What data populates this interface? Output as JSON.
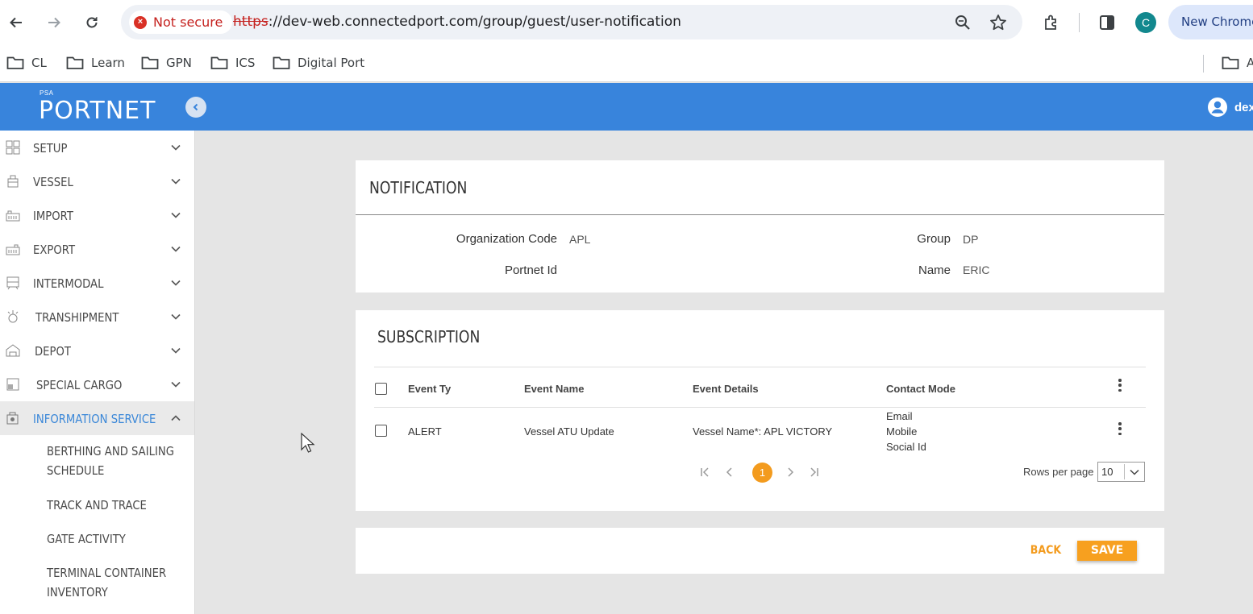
{
  "browser": {
    "security_label": "Not secure",
    "url_scheme": "https",
    "url_rest": "://dev-web.connectedport.com/group/guest/user-notification",
    "profile_initial": "C",
    "new_chrome_label": "New Chrome",
    "bookmarks": [
      "CL",
      "Learn",
      "GPN",
      "ICS",
      "Digital Port"
    ],
    "bookmark_right_fragment": "A"
  },
  "app": {
    "logo_small": "PSA",
    "logo_main": "PORTNET",
    "user_fragment": "dex",
    "accent_color": "#3884dc",
    "action_color": "#f39b1e"
  },
  "sidebar": {
    "items": [
      {
        "label": "SETUP",
        "icon": "grid-icon",
        "expanded": false
      },
      {
        "label": "VESSEL",
        "icon": "ship-icon",
        "expanded": false
      },
      {
        "label": "IMPORT",
        "icon": "import-icon",
        "expanded": false
      },
      {
        "label": "EXPORT",
        "icon": "export-icon",
        "expanded": false
      },
      {
        "label": "INTERMODAL",
        "icon": "train-icon",
        "expanded": false
      },
      {
        "label": "TRANSHIPMENT",
        "icon": "crane-icon",
        "expanded": false
      },
      {
        "label": "DEPOT",
        "icon": "warehouse-icon",
        "expanded": false
      },
      {
        "label": "SPECIAL CARGO",
        "icon": "cargo-icon",
        "expanded": false
      },
      {
        "label": "INFORMATION SERVICE",
        "icon": "info-service-icon",
        "expanded": true
      }
    ],
    "subitems": [
      "BERTHING AND SAILING SCHEDULE",
      "TRACK AND TRACE",
      "GATE ACTIVITY",
      "TERMINAL CONTAINER INVENTORY"
    ]
  },
  "notification": {
    "title": "NOTIFICATION",
    "org_code_label": "Organization Code",
    "org_code_value": "APL",
    "portnet_id_label": "Portnet Id",
    "portnet_id_value": "",
    "group_label": "Group",
    "group_value": "DP",
    "name_label": "Name",
    "name_value": "ERIC"
  },
  "subscription": {
    "title": "SUBSCRIPTION",
    "columns": [
      "Event Ty",
      "Event Name",
      "Event Details",
      "Contact Mode"
    ],
    "rows": [
      {
        "event_type": "ALERT",
        "event_name": "Vessel ATU Update",
        "event_details": "Vessel Name*: APL VICTORY",
        "contact_modes": [
          "Email",
          "Mobile",
          "Social Id"
        ]
      }
    ],
    "current_page": "1",
    "rows_per_page_label": "Rows per page",
    "rows_per_page_value": "10"
  },
  "actions": {
    "back_label": "BACK",
    "save_label": "SAVE"
  }
}
